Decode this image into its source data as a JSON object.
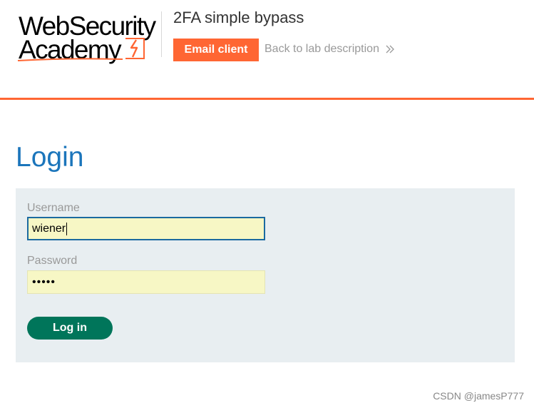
{
  "header": {
    "logo": {
      "line1": "WebSecurity",
      "line2": "Academy"
    },
    "lab_title": "2FA simple bypass",
    "email_button": "Email client",
    "back_link": "Back to lab description",
    "back_icon": "double-chevron-right-icon"
  },
  "colors": {
    "brand_orange": "#ff6633",
    "heading_blue": "#1b75bb",
    "button_green": "#00755a",
    "panel_bg": "#e8eef1",
    "input_bg": "#f7f7c5"
  },
  "login": {
    "heading": "Login",
    "username_label": "Username",
    "username_value": "wiener",
    "password_label": "Password",
    "password_value": "•••••",
    "submit_label": "Log in"
  },
  "watermark": "CSDN @jamesP777"
}
